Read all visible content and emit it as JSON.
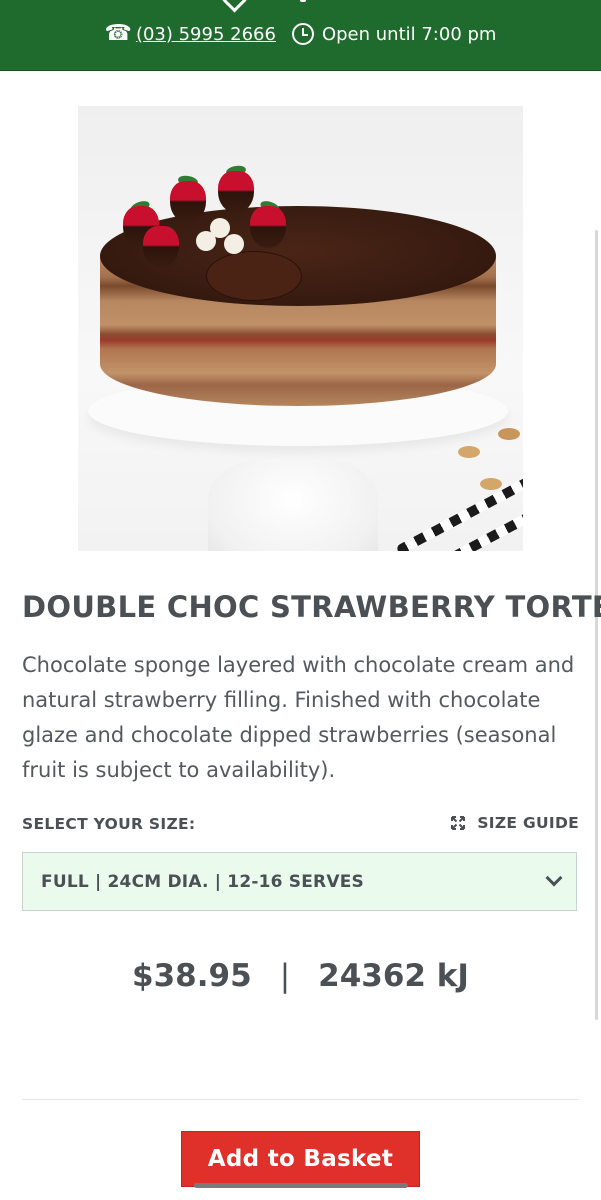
{
  "header": {
    "phone_icon": "telephone-icon",
    "phone": "(03) 5995 2666",
    "clock_icon": "clock-icon",
    "hours": "Open until 7:00 pm",
    "background_color": "#1f6b2d"
  },
  "product": {
    "image_alt": "Double Choc Strawberry Torte",
    "title": "DOUBLE CHOC STRAWBERRY TORTE",
    "description": "Chocolate sponge layered with chocolate cream and natural strawberry filling. Finished with chocolate glaze and chocolate dipped strawberries (seasonal fruit is subject to availability)."
  },
  "size": {
    "label": "SELECT YOUR SIZE:",
    "guide_icon": "expand-icon",
    "guide_label": "SIZE GUIDE",
    "selected": "FULL | 24CM DIA. | 12-16 SERVES",
    "select_background": "#eafbee"
  },
  "pricing": {
    "price": "$38.95",
    "separator": "|",
    "energy": "24362 kJ"
  },
  "actions": {
    "add_to_basket": "Add to Basket",
    "button_color": "#e0302a"
  }
}
